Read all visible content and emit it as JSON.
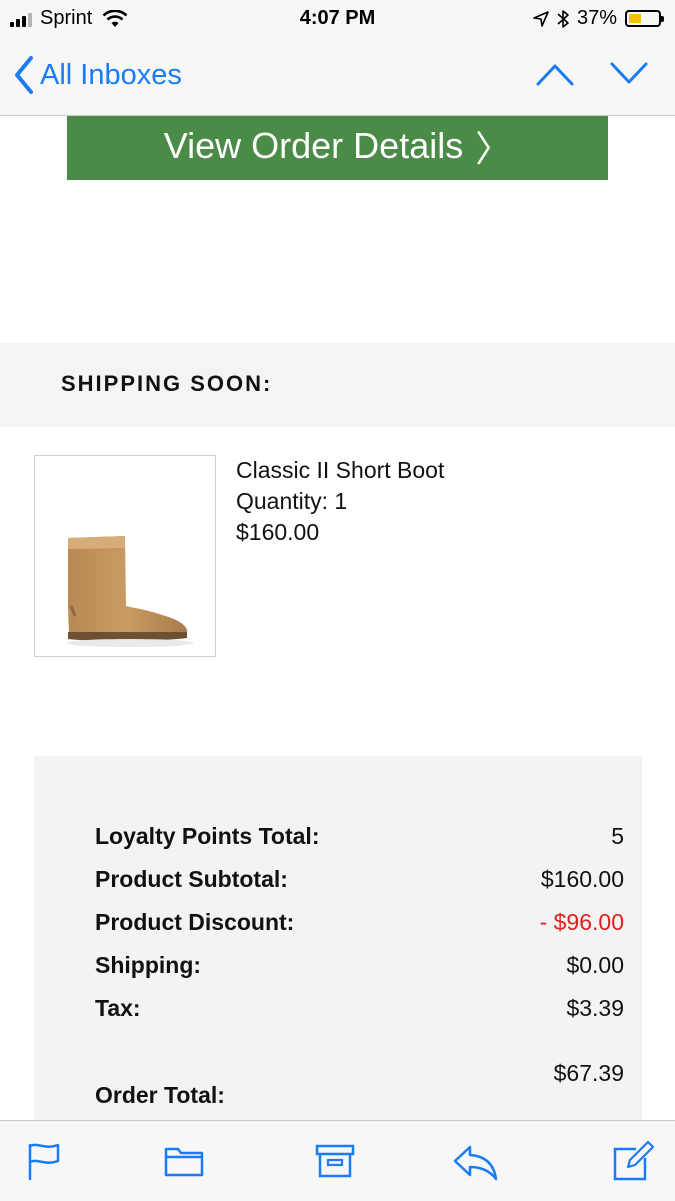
{
  "status_bar": {
    "carrier": "Sprint",
    "time": "4:07 PM",
    "battery": "37%"
  },
  "nav": {
    "back_label": "All Inboxes",
    "icons": [
      "chevron-left-icon",
      "chevron-up-icon",
      "chevron-down-icon"
    ]
  },
  "email": {
    "order_button_label": "View Order Details",
    "order_button_icon": "〉",
    "shipping_title": "SHIPPING SOON:",
    "product": {
      "name": "Classic II Short Boot",
      "quantity": "Quantity: 1",
      "price": "$160.00"
    },
    "summary": {
      "loyalty_label": "Loyalty Points Total:",
      "loyalty_value": "5",
      "subtotal_label": "Product Subtotal:",
      "subtotal_value": "$160.00",
      "discount_label": "Product Discount:",
      "discount_value": "- $96.00",
      "shipping_label": "Shipping:",
      "shipping_value": "$0.00",
      "tax_label": "Tax:",
      "tax_value": "$3.39",
      "total_label": "Order Total:",
      "total_value": "$67.39"
    }
  },
  "toolbar": {
    "icons": [
      "flag-icon",
      "folder-icon",
      "archive-icon",
      "reply-icon",
      "compose-icon"
    ]
  },
  "colors": {
    "ios_blue": "#1a7cf5",
    "button_green": "#4a8b48",
    "discount_red": "#e01e1e",
    "battery_yellow": "#f2c200"
  }
}
